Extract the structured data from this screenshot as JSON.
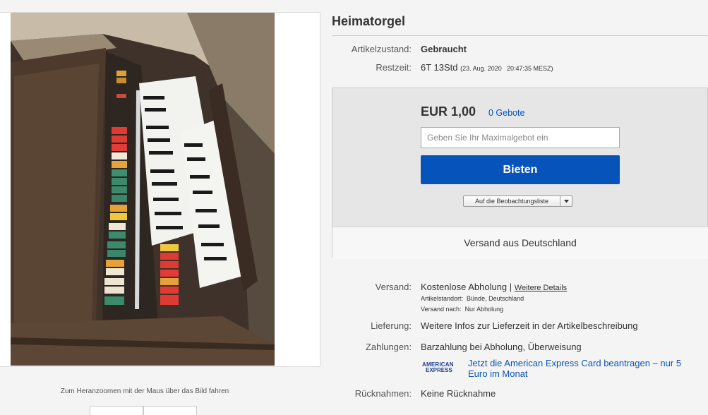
{
  "listing": {
    "title": "Heimatorgel",
    "condition_label": "Artikelzustand:",
    "condition_value": "Gebraucht",
    "time_label": "Restzeit:",
    "time_left": "6T 13Std",
    "end_date": "(23. Aug. 2020",
    "end_time": "20:47:35 MESZ)"
  },
  "bid": {
    "price": "EUR 1,00",
    "bid_count": "0 Gebote",
    "input_placeholder": "Geben Sie Ihr Maximalgebot ein",
    "button_label": "Bieten",
    "watchlist_label": "Auf die Beobachtungsliste",
    "ship_from": "Versand aus Deutschland"
  },
  "shipping": {
    "label": "Versand:",
    "value": "Kostenlose Abholung",
    "separator": "|",
    "details_link": "Weitere Details",
    "location_label": "Artikelstandort:",
    "location_value": "Bünde, Deutschland",
    "ships_to_label": "Versand nach:",
    "ships_to_value": "Nur Abholung"
  },
  "delivery": {
    "label": "Lieferung:",
    "value": "Weitere Infos zur Lieferzeit in der Artikelbeschreibung"
  },
  "payment": {
    "label": "Zahlungen:",
    "value": "Barzahlung bei Abholung, Überweisung",
    "amex_logo_line1": "AMERICAN",
    "amex_logo_line2": "EXPRESS",
    "amex_promo": "Jetzt die American Express Card beantragen – nur 5 Euro im Monat"
  },
  "returns": {
    "label": "Rücknahmen:",
    "value": "Keine Rücknahme"
  },
  "gallery": {
    "zoom_hint": "Zum Heranzoomen mit der Maus über das Bild fahren"
  },
  "colors": {
    "link_blue": "#0654ba",
    "bid_button": "#0654ba",
    "bid_box_bg": "#e6e6e6",
    "page_bg": "#f4f4f4"
  },
  "icons": [
    "chevron-down-icon",
    "american-express-logo"
  ]
}
